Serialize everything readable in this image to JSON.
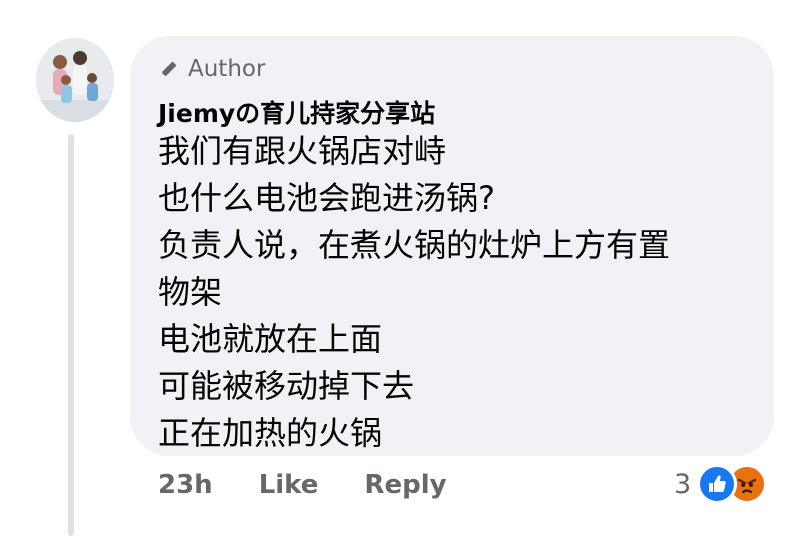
{
  "comment": {
    "author_badge": "Author",
    "author_name": "Jiemyの育儿持家分享站",
    "lines": [
      "我们有跟火锅店对峙",
      "也什么电池会跑进汤锅?",
      "负责人说，在煮火锅的灶炉上方有置",
      "物架",
      "电池就放在上面",
      "可能被移动掉下去",
      "正在加热的火锅"
    ]
  },
  "actions": {
    "time": "23h",
    "like": "Like",
    "reply": "Reply"
  },
  "reactions": {
    "count": "3",
    "icons": [
      "like-icon",
      "angry-icon"
    ],
    "like_color": "#1877f2",
    "angry_color": "#e9710f"
  },
  "colors": {
    "bubble": "#f0f2f5",
    "muted_text": "#65676b",
    "text": "#050505"
  }
}
